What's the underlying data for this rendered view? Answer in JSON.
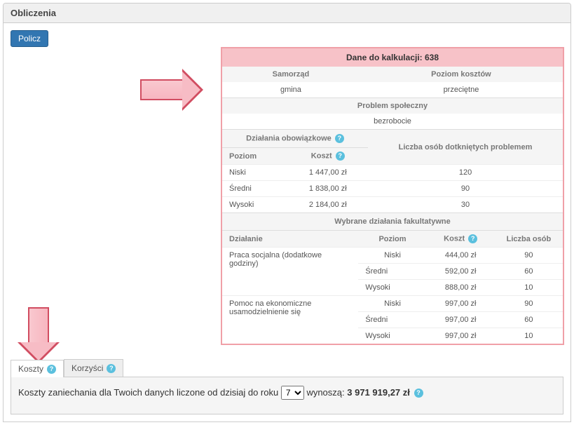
{
  "panel": {
    "title": "Obliczenia",
    "calc_button": "Policz"
  },
  "box": {
    "title_prefix": "Dane do kalkulacji: ",
    "id": "638",
    "cols": {
      "samorzad": "Samorząd",
      "poziom_kosztow": "Poziom kosztów"
    },
    "vals": {
      "samorzad": "gmina",
      "poziom_kosztow": "przeciętne"
    },
    "problem_label": "Problem społeczny",
    "problem_value": "bezrobocie",
    "mandatory_header": "Działania obowiązkowe",
    "col_poziom": "Poziom",
    "col_koszt": "Koszt",
    "col_liczba_long": "Liczba osób dotkniętych problemem",
    "mandatory_rows": [
      {
        "poziom": "Niski",
        "koszt": "1 447,00 zł",
        "liczba": "120"
      },
      {
        "poziom": "Średni",
        "koszt": "1 838,00 zł",
        "liczba": "90"
      },
      {
        "poziom": "Wysoki",
        "koszt": "2 184,00 zł",
        "liczba": "30"
      }
    ],
    "optional_header": "Wybrane działania fakultatywne",
    "col_dzialanie": "Działanie",
    "col_liczba": "Liczba osób",
    "optional": [
      {
        "name": "Praca socjalna (dodatkowe godziny)",
        "rows": [
          {
            "poziom": "Niski",
            "koszt": "444,00 zł",
            "liczba": "90"
          },
          {
            "poziom": "Średni",
            "koszt": "592,00 zł",
            "liczba": "60"
          },
          {
            "poziom": "Wysoki",
            "koszt": "888,00 zł",
            "liczba": "10"
          }
        ]
      },
      {
        "name": "Pomoc na ekonomiczne usamodzielnienie się",
        "rows": [
          {
            "poziom": "Niski",
            "koszt": "997,00 zł",
            "liczba": "90"
          },
          {
            "poziom": "Średni",
            "koszt": "997,00 zł",
            "liczba": "60"
          },
          {
            "poziom": "Wysoki",
            "koszt": "997,00 zł",
            "liczba": "10"
          }
        ]
      }
    ]
  },
  "tabs": {
    "koszty": "Koszty",
    "korzysci": "Korzyści"
  },
  "result": {
    "prefix": "Koszty zaniechania dla Twoich danych liczone od dzisiaj do roku ",
    "year": "7",
    "middle": " wynoszą: ",
    "amount": "3 971 919,27 zł"
  }
}
